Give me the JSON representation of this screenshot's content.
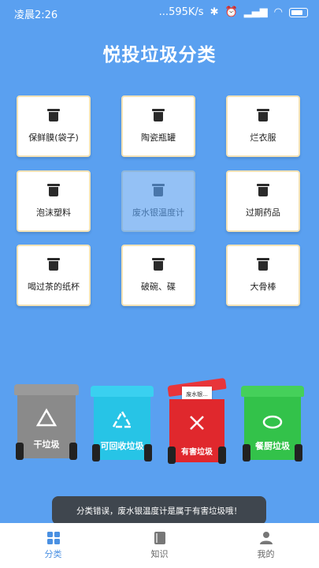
{
  "status": {
    "time": "凌晨2:26",
    "net": "...595K/s"
  },
  "title": "悦投垃圾分类",
  "items": [
    {
      "label": "保鲜膜(袋子)"
    },
    {
      "label": "陶瓷瓶罐"
    },
    {
      "label": "烂衣服"
    },
    {
      "label": "泡沫塑料"
    },
    {
      "label": "废水银温度计"
    },
    {
      "label": "过期药品"
    },
    {
      "label": "喝过茶的纸杯"
    },
    {
      "label": "破碗、碟"
    },
    {
      "label": "大骨棒"
    }
  ],
  "bins": [
    {
      "label": "干垃圾",
      "color": "#8a8a8a"
    },
    {
      "label": "可回收垃圾",
      "color": "#27c4e6"
    },
    {
      "label": "有害垃圾",
      "color": "#e0282d"
    },
    {
      "label": "餐厨垃圾",
      "color": "#33c24a"
    }
  ],
  "hazard_tag": "废水银...",
  "toast": "分类错误，废水银温度计是属于有害垃圾哦！",
  "tabs": [
    {
      "label": "分类",
      "icon": "grid-icon"
    },
    {
      "label": "知识",
      "icon": "book-icon"
    },
    {
      "label": "我的",
      "icon": "person-icon"
    }
  ],
  "colors": {
    "accent": "#4a90e2",
    "background": "#5aa0f0"
  }
}
